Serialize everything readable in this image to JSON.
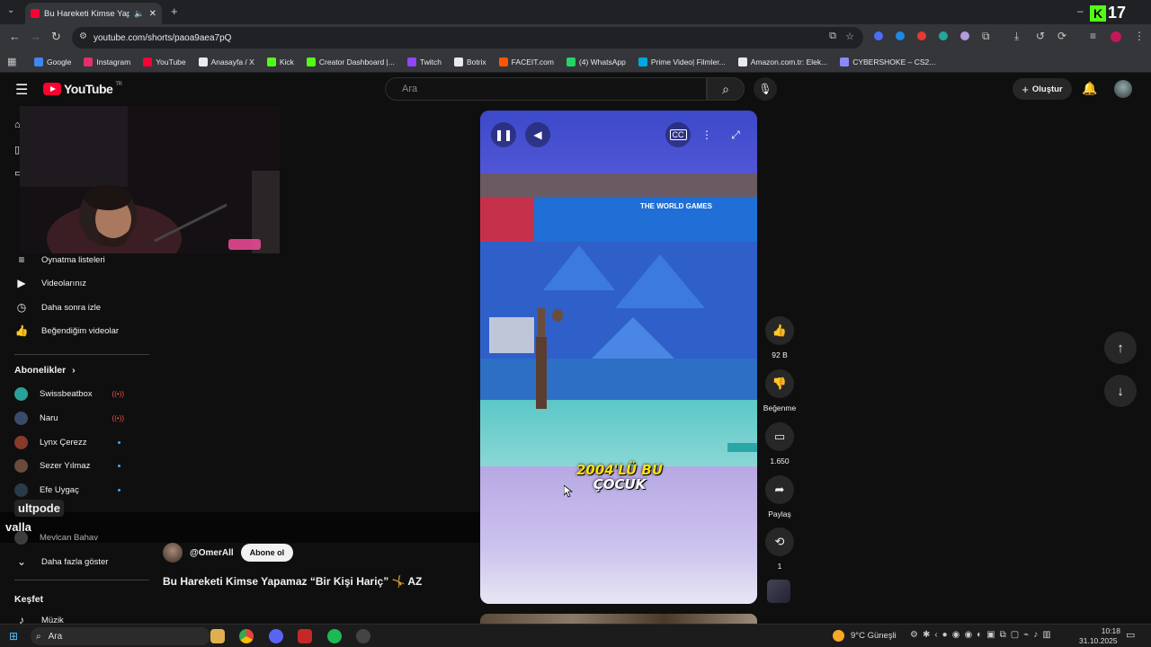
{
  "browser": {
    "tab_title": "Bu Hareketi Kimse Yapamaz",
    "url": "youtube.com/shorts/paoa9aea7pQ",
    "bookmarks": [
      {
        "label": "Google",
        "color": "#4285f4"
      },
      {
        "label": "Instagram",
        "color": "#e1306c"
      },
      {
        "label": "YouTube",
        "color": "#ff0033"
      },
      {
        "label": "Anasayfa / X",
        "color": "#e8eaed"
      },
      {
        "label": "Kick",
        "color": "#53fc18"
      },
      {
        "label": "Creator Dashboard |...",
        "color": "#53fc18"
      },
      {
        "label": "Twitch",
        "color": "#9146ff"
      },
      {
        "label": "Botrix",
        "color": "#e8eaed"
      },
      {
        "label": "FACEIT.com",
        "color": "#ff5500"
      },
      {
        "label": "(4) WhatsApp",
        "color": "#25d366"
      },
      {
        "label": "Prime Video| Filmler...",
        "color": "#00a8e1"
      },
      {
        "label": "Amazon.com.tr: Elek...",
        "color": "#e8eaed"
      },
      {
        "label": "CYBERSHOKE – CS2...",
        "color": "#8a8aff"
      }
    ]
  },
  "header": {
    "logo_text": "YouTube",
    "logo_region": "TR",
    "search_placeholder": "Ara",
    "create_label": "Oluştur"
  },
  "sidebar": {
    "you_items": [
      {
        "label": "Oynatma listeleri",
        "icon": "playlist-icon"
      },
      {
        "label": "Videolarınız",
        "icon": "video-icon"
      },
      {
        "label": "Daha sonra izle",
        "icon": "clock-icon"
      },
      {
        "label": "Beğendiğim videolar",
        "icon": "thumb-up-icon"
      }
    ],
    "subscriptions_title": "Abonelikler",
    "subscriptions": [
      {
        "label": "Swissbeatbox",
        "status": "live",
        "color": "#2aa198"
      },
      {
        "label": "Naru",
        "status": "live",
        "color": "#3a4a6a"
      },
      {
        "label": "Lynx Çerezz",
        "status": "new",
        "color": "#8a3a2a"
      },
      {
        "label": "Sezer Yılmaz",
        "status": "new",
        "color": "#6a4a3a"
      },
      {
        "label": "Efe Uygaç",
        "status": "new",
        "color": "#2a3a4a"
      },
      {
        "label": "Mevlcan Bahav",
        "status": "",
        "color": "#555555"
      }
    ],
    "show_more_label": "Daha fazla göster",
    "explore_title": "Keşfet",
    "explore_items": [
      {
        "label": "Müzik"
      }
    ]
  },
  "video": {
    "caption_line1": "2004'LÜ BU",
    "caption_line2": "ÇOCUK",
    "banner_text": "THE WORLD GAMES"
  },
  "actions": {
    "likes": "92 B",
    "dislike_label": "Beğenme",
    "comments": "1.650",
    "share_label": "Paylaş",
    "remix_count": "1"
  },
  "meta": {
    "channel_handle": "@OmerAll",
    "subscribe_label": "Abone ol",
    "title": "Bu Hareketi Kimse Yapamaz “Bir Kişi Hariç” 🤸 AZ"
  },
  "stream_overlay": {
    "chat_line1": "ultpode",
    "chat_line2": "valla",
    "viewer_count": "17"
  },
  "taskbar": {
    "search_label": "Ara",
    "weather": "9°C Güneşli",
    "time": "10:18",
    "date": "31.10.2025"
  }
}
